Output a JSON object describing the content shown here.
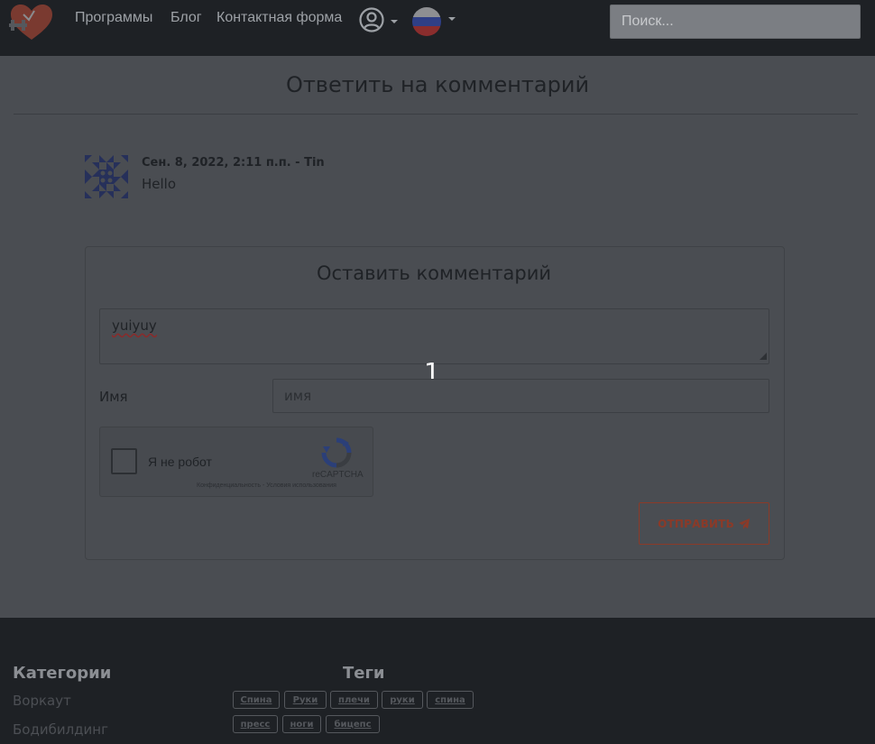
{
  "navbar": {
    "links": [
      "Программы",
      "Блог",
      "Контактная форма"
    ],
    "search_placeholder": "Поиск..."
  },
  "page": {
    "title": "Ответить на комментарий"
  },
  "comment": {
    "meta": "Сен. 8, 2022, 2:11 п.п. -  Tin",
    "text": "Hello"
  },
  "form": {
    "title": "Оставить комментарий",
    "textarea_value": "yuiyuy",
    "name_label": "Имя",
    "name_placeholder": "имя",
    "recaptcha_label": "Я не робот",
    "recaptcha_brand": "reCAPTCHA",
    "recaptcha_links": "Конфиденциальность - Условия использования",
    "submit_label": "ОТПРАВИТЬ"
  },
  "overlay": {
    "number": "1"
  },
  "footer": {
    "categories_title": "Категории",
    "categories": [
      "Воркаут",
      "Бодибилдинг"
    ],
    "tags_title": "Теги",
    "tags_row1": [
      "Спина",
      "Руки",
      "плечи",
      "руки",
      "спина"
    ],
    "tags_row2": [
      "пресс",
      "ноги",
      "бицепс"
    ]
  },
  "colors": {
    "navbar_bg": "#1e2125",
    "page_bg": "#4a4d52",
    "accent": "#8b3a28"
  }
}
